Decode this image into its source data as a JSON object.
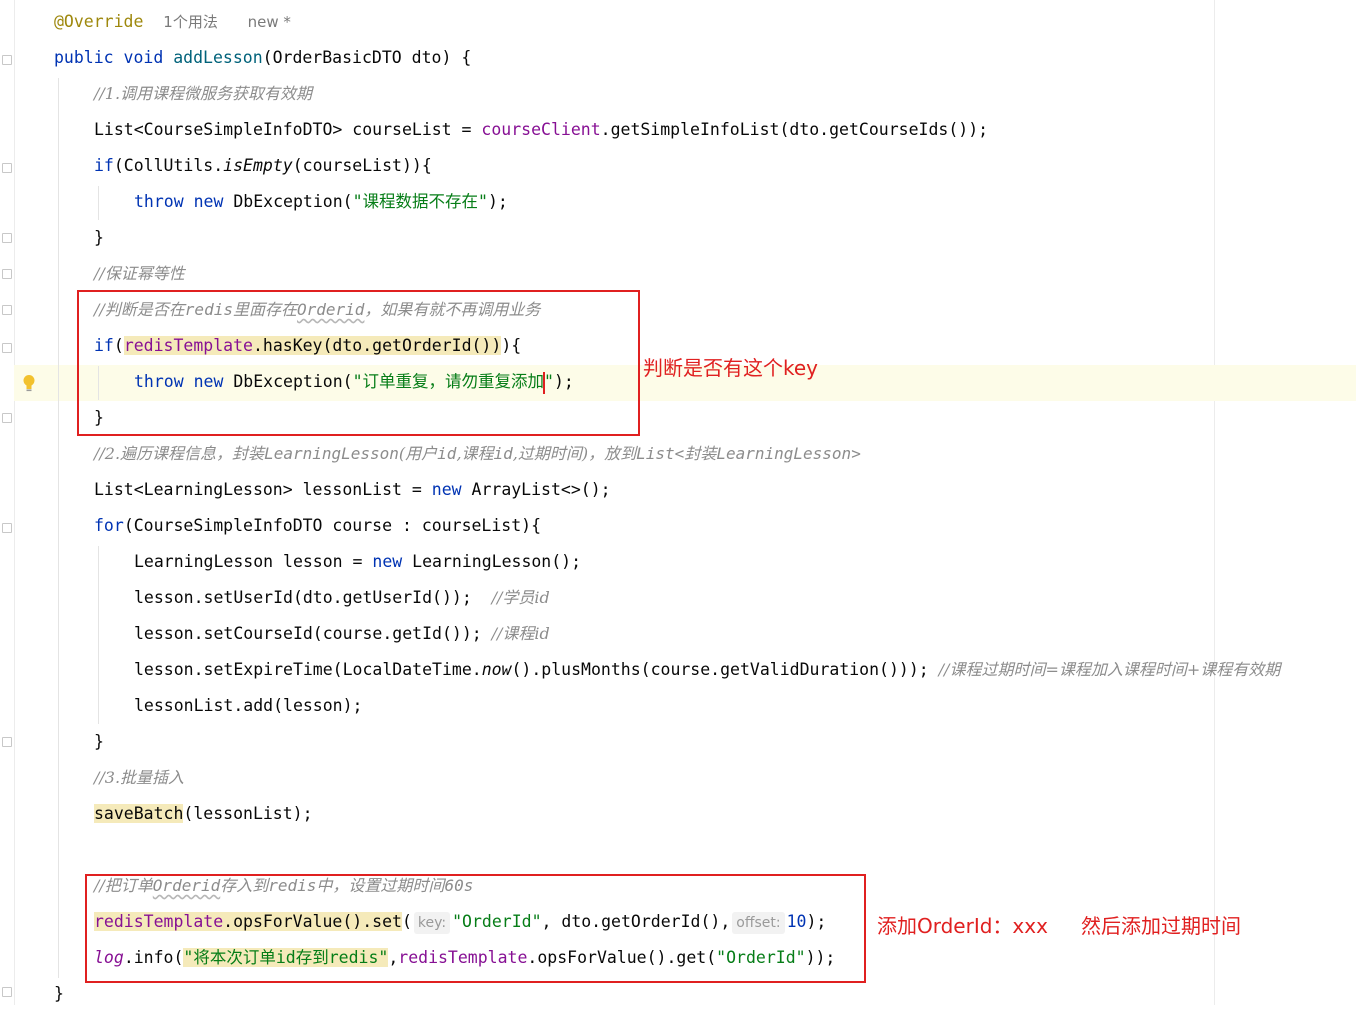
{
  "editor": {
    "usage_hint": "1个用法",
    "new_hint": "new *",
    "hint_key": "key:",
    "hint_offset": "offset:",
    "line_override": "@Override",
    "lines": {
      "comment1": "//1.调用课程微服务获取有效期",
      "comment_idem": "//保证幂等性",
      "comment_check_a": "//判断是否在",
      "comment_check_b": "redis",
      "comment_check_c": "里面存在",
      "comment_check_d": "Orderid",
      "comment_check_e": "，如果有就不再调用业务",
      "exception_str1": "\"课程数据不存在\"",
      "exception_str2a": "\"订单重复，请勿重复添加",
      "exception_str2b": "\"",
      "comment2a": "//2.遍历课程信息，封装",
      "comment2b": "LearningLesson",
      "comment2c": "(用户",
      "comment2d": "id",
      "comment2e": ",课程",
      "comment2f": "id",
      "comment2g": ",过期时间)，放到",
      "comment2h": "List<",
      "comment2i": "封装",
      "comment2j": "LearningLesson>",
      "comment_student": "//学员id",
      "comment_course": "//课程id",
      "comment_expire": "//课程过期时间=课程加入课程时间+课程有效期",
      "comment3": "//3.批量插入",
      "comment_store_a": "//把订单",
      "comment_store_b": "Orderid",
      "comment_store_c": "存入到",
      "comment_store_d": "redis",
      "comment_store_e": "中，设置过期时间",
      "comment_store_f": "60s",
      "orderid_str": "\"OrderId\"",
      "offset_val": "10",
      "log_str": "\"将本次订单id存到redis\"",
      "orderid_str2": "\"OrderId\""
    }
  },
  "annotations": {
    "note1": "判断是否有这个key",
    "note2": "添加OrderId：xxx",
    "note3": "然后添加过期时间"
  },
  "colors": {
    "keyword": "#0033b3",
    "method": "#00627a",
    "field": "#871094",
    "string": "#067d17",
    "comment": "#8c8c8c",
    "annotation_red": "#e02020"
  }
}
